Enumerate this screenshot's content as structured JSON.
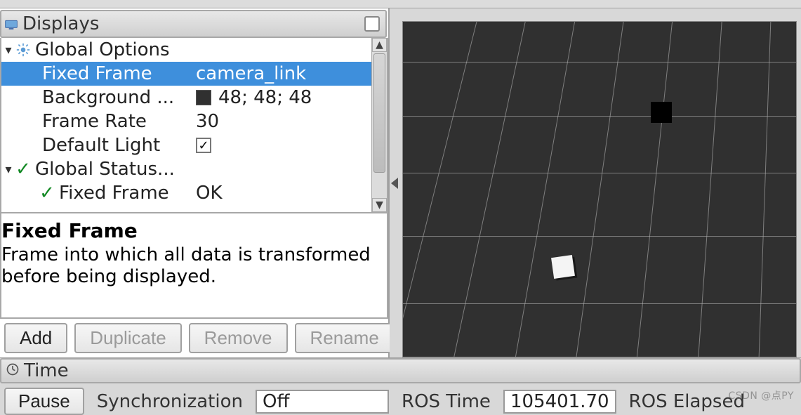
{
  "displays_panel": {
    "title": "Displays",
    "tree": {
      "global_options": {
        "label": "Global Options",
        "fixed_frame": {
          "key": "Fixed Frame",
          "value": "camera_link"
        },
        "background": {
          "key": "Background ...",
          "value": "48; 48; 48",
          "swatch": "#303030"
        },
        "frame_rate": {
          "key": "Frame Rate",
          "value": "30"
        },
        "default_light": {
          "key": "Default Light",
          "checked": true
        }
      },
      "global_status": {
        "label": "Global Status...",
        "fixed_frame": {
          "key": "Fixed Frame",
          "value": "OK"
        }
      }
    },
    "description": {
      "title": "Fixed Frame",
      "body": "Frame into which all data is transformed before being displayed."
    },
    "buttons": {
      "add": "Add",
      "duplicate": "Duplicate",
      "remove": "Remove",
      "rename": "Rename"
    }
  },
  "time_panel": {
    "title": "Time",
    "pause": "Pause",
    "sync_label": "Synchronization",
    "sync_value": "Off",
    "ros_time_label": "ROS Time",
    "ros_time_value": "105401.70",
    "ros_elapsed_label": "ROS Elapsed"
  },
  "watermark": "CSDN @点PY"
}
